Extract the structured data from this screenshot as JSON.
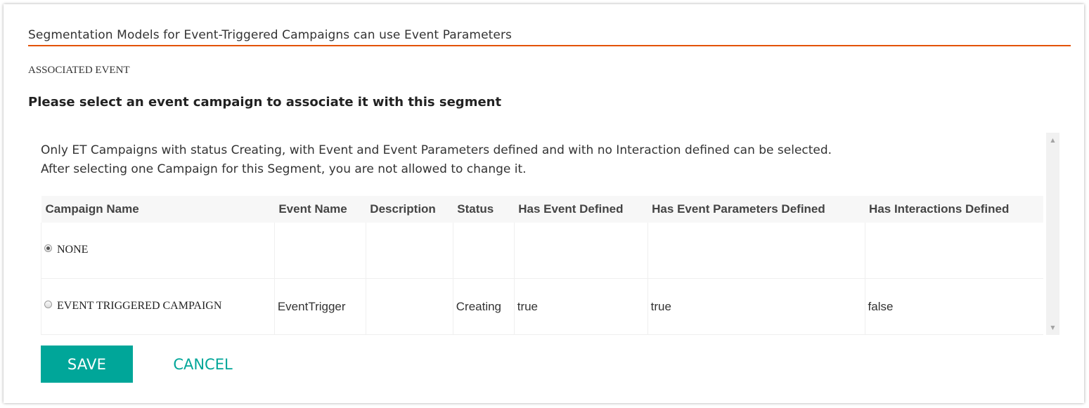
{
  "dialog": {
    "title": "Segmentation Models for Event-Triggered Campaigns can use Event Parameters",
    "accent_color": "#e35205",
    "section_label": "ASSOCIATED EVENT",
    "prompt": "Please select an event campaign to associate it with this segment"
  },
  "panel": {
    "info_line_1": "Only ET Campaigns with status Creating, with Event and Event Parameters defined and with no Interaction defined can be selected.",
    "info_line_2": "After selecting one Campaign for this Segment, you are not allowed to change it."
  },
  "table": {
    "columns": [
      "Campaign Name",
      "Event Name",
      "Description",
      "Status",
      "Has Event Defined",
      "Has Event Parameters Defined",
      "Has Interactions Defined"
    ],
    "rows": [
      {
        "campaign_name": "NONE",
        "selected": true,
        "event_name": "",
        "description": "",
        "status": "",
        "has_event_defined": "",
        "has_event_parameters_defined": "",
        "has_interactions_defined": ""
      },
      {
        "campaign_name": "EVENT TRIGGERED CAMPAIGN",
        "selected": false,
        "event_name": "EventTrigger",
        "description": "",
        "status": "Creating",
        "has_event_defined": "true",
        "has_event_parameters_defined": "true",
        "has_interactions_defined": "false"
      }
    ]
  },
  "actions": {
    "save_label": "SAVE",
    "cancel_label": "CANCEL",
    "primary_color": "#00a699"
  },
  "icons": {
    "scroll_up": "scroll-up-arrow-icon",
    "scroll_down": "scroll-down-arrow-icon"
  }
}
